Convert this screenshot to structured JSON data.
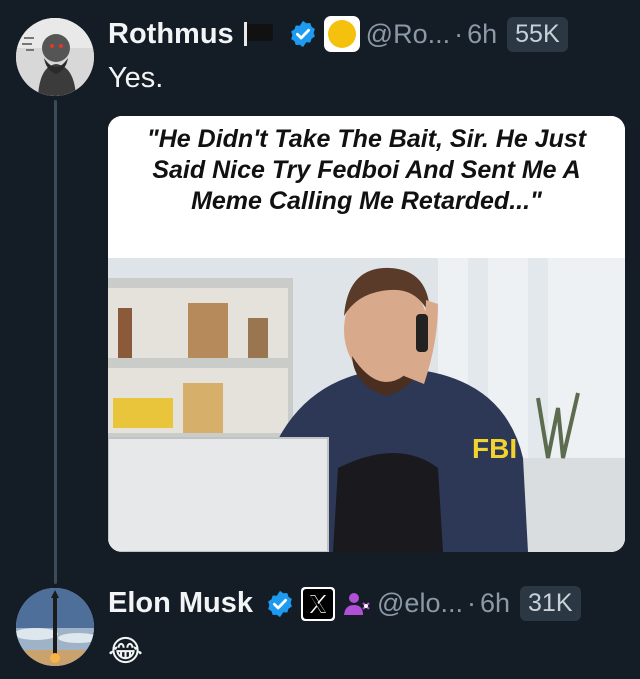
{
  "tweets": [
    {
      "name": "Rothmus",
      "handle": "@Ro...",
      "separator": "·",
      "time": "6h",
      "views": "55K",
      "text": "Yes.",
      "media_caption": "\"He Didn't Take The Bait, Sir. He Just Said Nice Try Fedboi And Sent Me A Meme Calling Me Retarded...\"",
      "media_badge": "FBI"
    },
    {
      "name": "Elon Musk",
      "handle": "@elo...",
      "separator": "·",
      "time": "6h",
      "views": "31K",
      "text": "😂"
    }
  ],
  "colors": {
    "background": "#141d26",
    "verified": "#1d9bf0",
    "muted": "#8b98a5"
  },
  "icons": [
    "black-flag-icon",
    "verified-badge-icon",
    "gold-circle-icon",
    "x-logo-icon",
    "person-badge-icon"
  ]
}
